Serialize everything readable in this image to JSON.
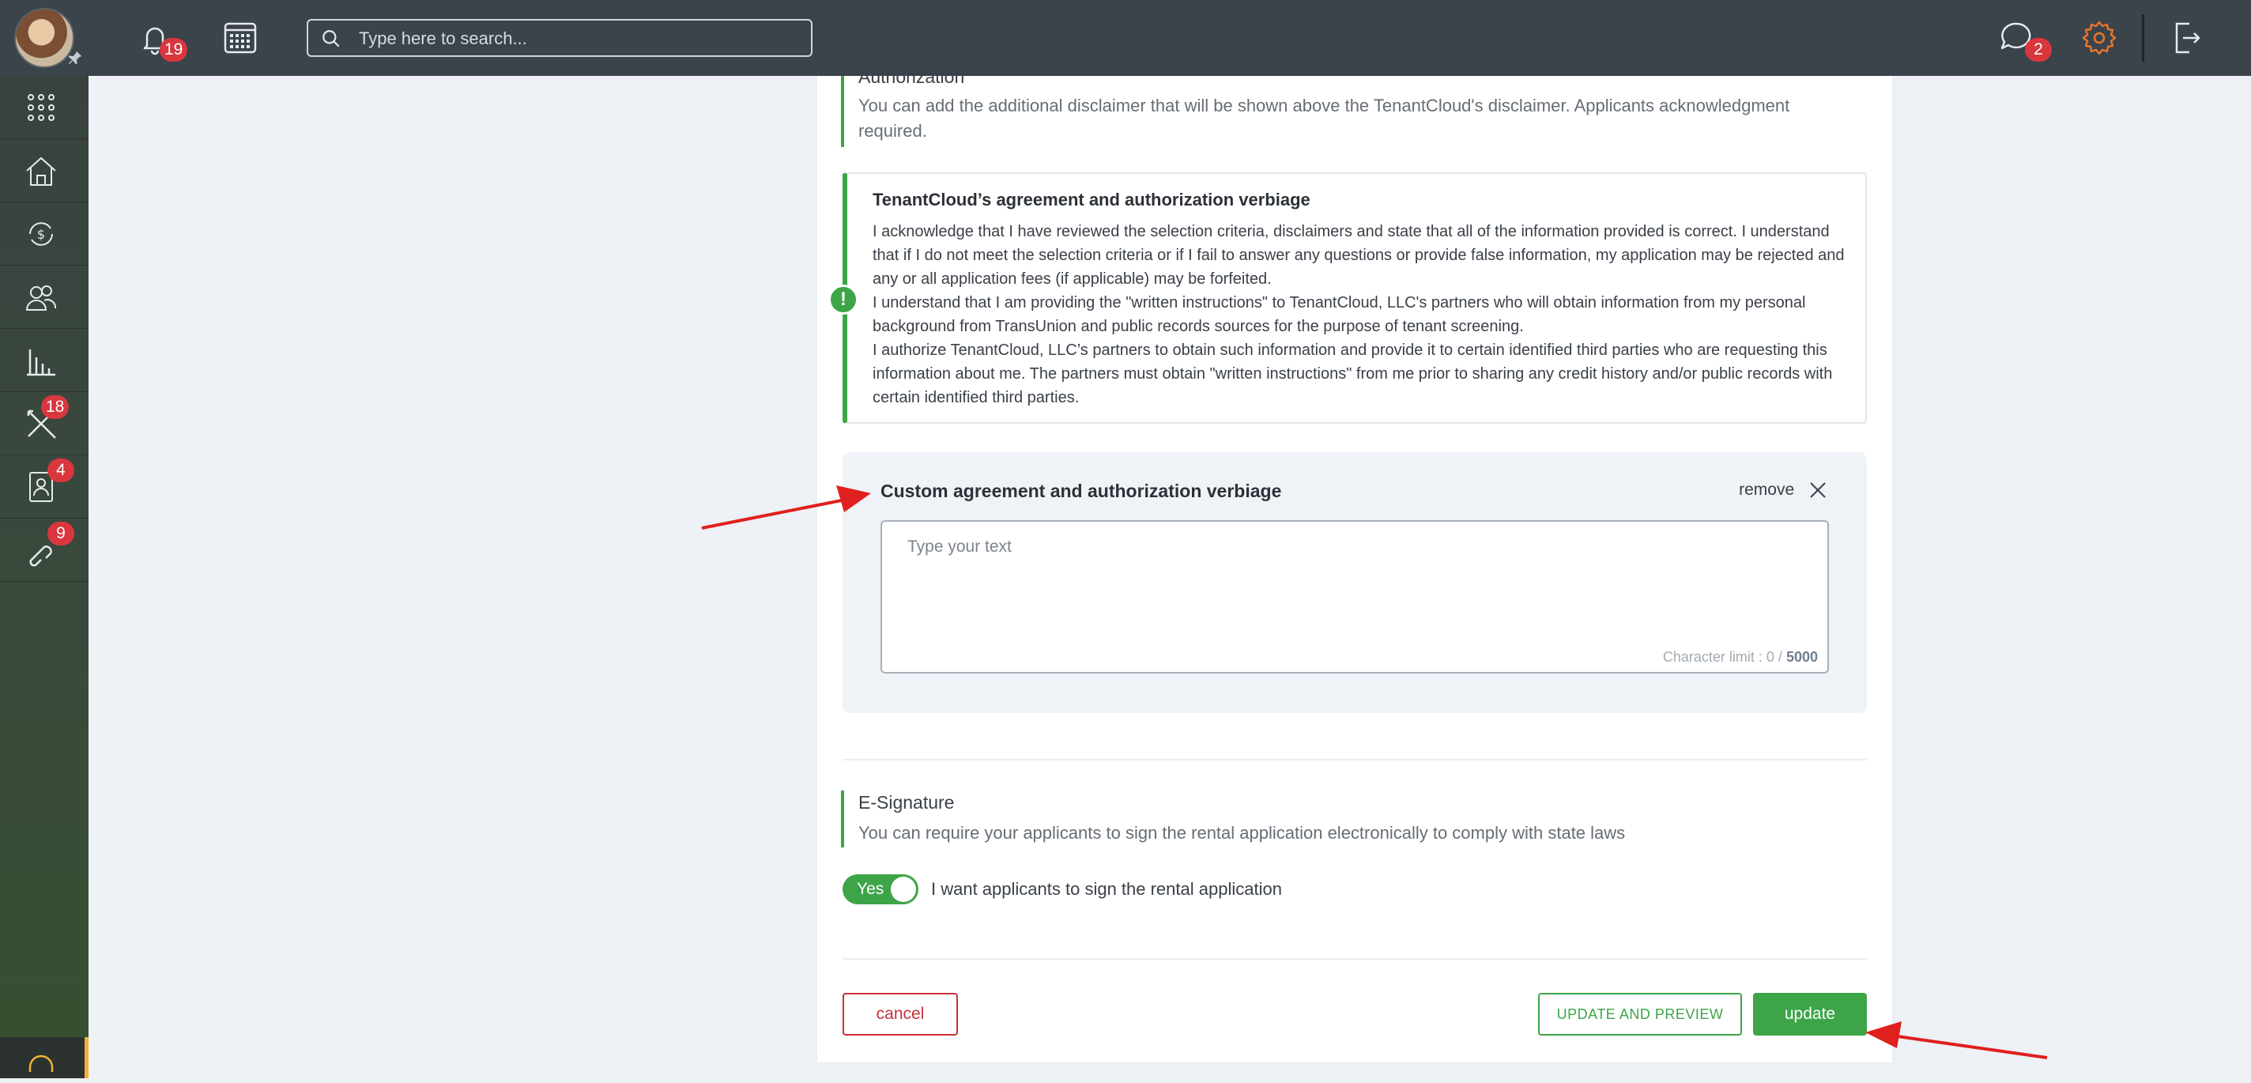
{
  "topbar": {
    "notifications_count": "19",
    "search_placeholder": "Type here to search...",
    "messages_count": "2"
  },
  "sidebar": {
    "items": [
      {
        "icon": "apps-grid-icon",
        "badge": ""
      },
      {
        "icon": "properties-icon",
        "badge": ""
      },
      {
        "icon": "accounting-icon",
        "badge": ""
      },
      {
        "icon": "contacts-icon",
        "badge": ""
      },
      {
        "icon": "reports-icon",
        "badge": ""
      },
      {
        "icon": "maintenance-icon",
        "badge": "18"
      },
      {
        "icon": "applications-icon",
        "badge": "4"
      },
      {
        "icon": "leads-icon",
        "badge": "9"
      }
    ]
  },
  "authorization": {
    "title": "Authorization",
    "description": "You can add the additional disclaimer that will be shown above the TenantCloud's disclaimer. Applicants acknowledgment required."
  },
  "tenantcloud_agreement": {
    "title": "TenantCloud’s agreement and authorization verbiage",
    "paragraphs": [
      "I acknowledge that I have reviewed the selection criteria, disclaimers and state that all of the information provided is correct. I understand that if I do not meet the selection criteria or if I fail to answer any questions or provide false information, my application may be rejected and any or all application fees (if applicable) may be forfeited.",
      "I understand that I am providing the \"written instructions\" to TenantCloud, LLC's partners who will obtain information from my personal background from TransUnion and public records sources for the purpose of tenant screening.",
      "I authorize TenantCloud, LLC’s partners to obtain such information and provide it to certain identified third parties who are requesting this information about me. The partners must obtain \"written instructions\" from me prior to sharing any credit history and/or public records with certain identified third parties."
    ]
  },
  "custom_agreement": {
    "title": "Custom agreement and authorization verbiage",
    "remove_label": "remove",
    "placeholder": "Type your text",
    "char_limit_label": "Character limit : 0 /",
    "char_limit_max": "5000"
  },
  "esignature": {
    "title": "E-Signature",
    "description": "You can require your applicants to sign the rental application electronically to comply with state laws",
    "toggle_value": "Yes",
    "toggle_label": "I want applicants to sign the rental application"
  },
  "actions": {
    "cancel_label": "cancel",
    "preview_label": "UPDATE AND PREVIEW",
    "update_label": "update"
  },
  "colors": {
    "accent_green": "#3da548",
    "danger_red": "#c9303a",
    "topbar": "#3b434b",
    "badge_red": "#d9363e",
    "annotation_red": "#e0201e",
    "settings_orange": "#e8752b"
  }
}
